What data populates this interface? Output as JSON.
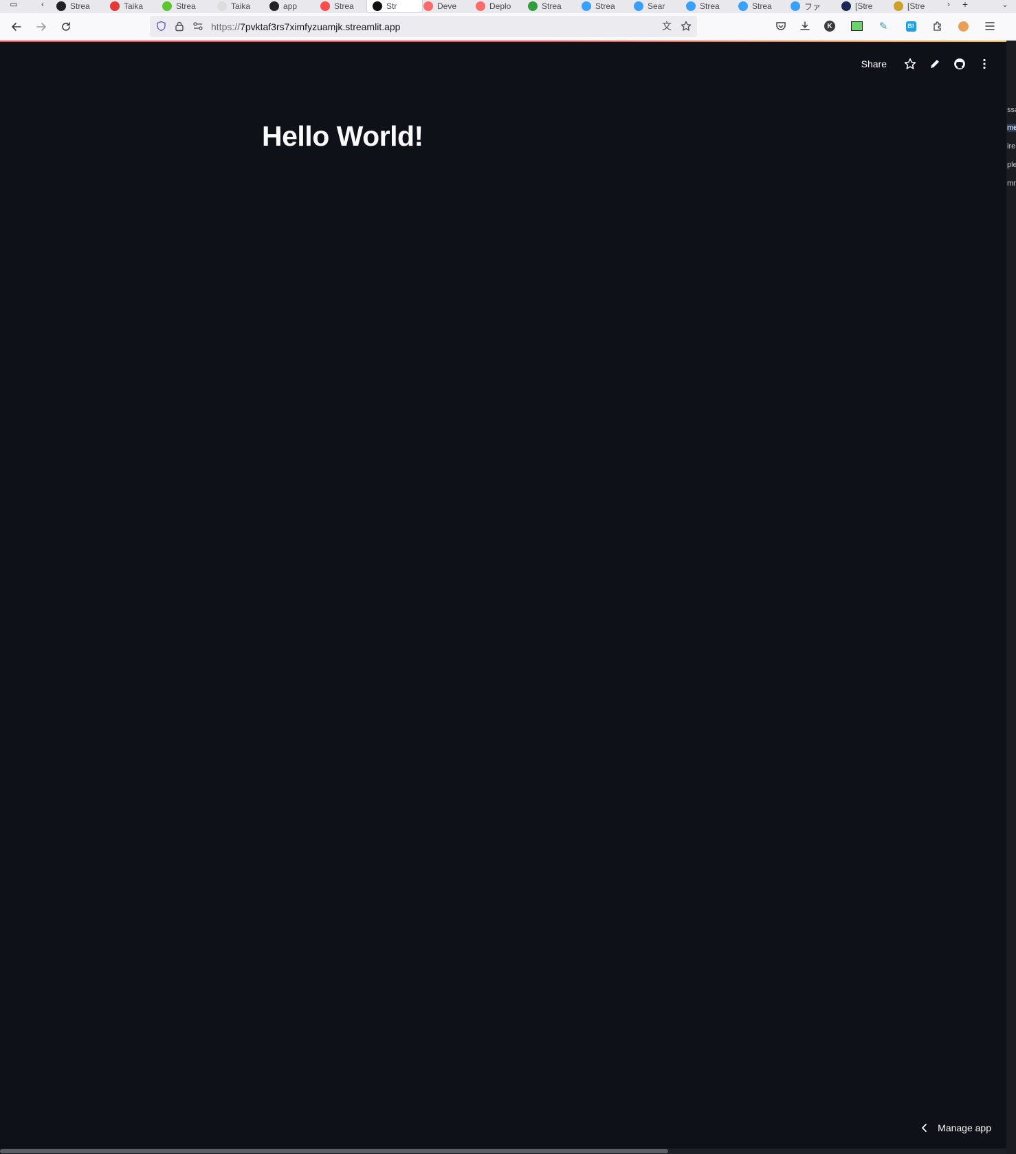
{
  "browser": {
    "tabs": [
      {
        "label": "Strea",
        "color": "#222222"
      },
      {
        "label": "Taika",
        "color": "#e53935"
      },
      {
        "label": "Strea",
        "color": "#5cc631"
      },
      {
        "label": "Taika",
        "color": "#dddddd"
      },
      {
        "label": "app",
        "color": "#222222"
      },
      {
        "label": "Strea",
        "color": "#ff4b4b"
      },
      {
        "label": "Str",
        "color": "#111111",
        "active": true
      },
      {
        "label": "Deve",
        "color": "#ff6b6b"
      },
      {
        "label": "Deplo",
        "color": "#ff6b6b"
      },
      {
        "label": "Strea",
        "color": "#2e9e3e"
      },
      {
        "label": "Strea",
        "color": "#3aa0ff"
      },
      {
        "label": "Sear",
        "color": "#3aa0ff"
      },
      {
        "label": "Strea",
        "color": "#3aa0ff"
      },
      {
        "label": "Strea",
        "color": "#3aa0ff"
      },
      {
        "label": "ファ",
        "color": "#3aa0ff"
      },
      {
        "label": "[Stre",
        "color": "#1b2a55"
      },
      {
        "label": "[Stre",
        "color": "#c9a227"
      }
    ],
    "url_protocol": "https://",
    "url_host": "7pvktaf3rs7ximfyzuamjk.streamlit.app",
    "icons": {
      "back": "arrow-left-icon",
      "forward": "arrow-right-icon",
      "reload": "reload-icon",
      "shield": "shield-icon",
      "lock": "lock-icon",
      "permissions": "permissions-icon",
      "translate": "translate-icon",
      "bookmark": "star-icon",
      "pocket": "pocket-icon",
      "downloads": "download-icon",
      "menu": "hamburger-menu-icon"
    }
  },
  "app": {
    "header": {
      "share_label": "Share"
    },
    "title": "Hello World!",
    "manage_app_label": "Manage app",
    "colors": {
      "background": "#0e1117",
      "text": "#fafafa",
      "accent": "#ff4b4b"
    }
  },
  "side_strip": [
    "ssa",
    "me",
    "ire",
    "ple",
    "mr"
  ]
}
